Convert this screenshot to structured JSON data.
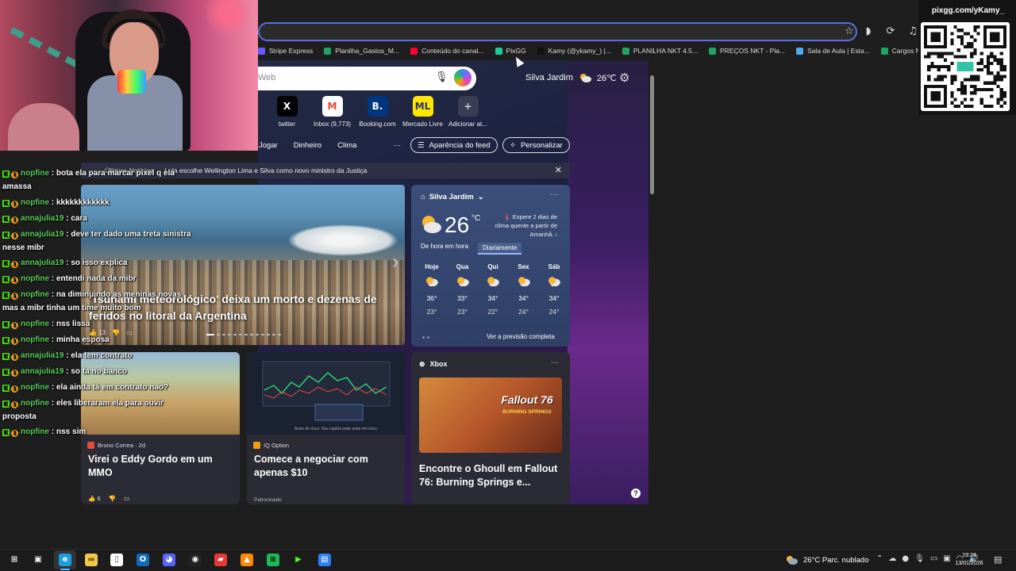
{
  "browser": {
    "address_icons": [
      "star-icon",
      "extension-icon",
      "refresh-icon",
      "music-icon"
    ],
    "bookmarks": [
      {
        "label": "Stripe Express",
        "color": "#635bff"
      },
      {
        "label": "Planilha_Gastos_M...",
        "color": "#1fa463"
      },
      {
        "label": "Conteúdo do canal...",
        "color": "#ff0033"
      },
      {
        "label": "PixGG",
        "color": "#20c997"
      },
      {
        "label": "Kamy (@ykamy_) |...",
        "color": "#111111"
      },
      {
        "label": "PLANILHA NKT 4.5...",
        "color": "#1fa463"
      },
      {
        "label": "PREÇOS NKT - Pla...",
        "color": "#1fa463"
      },
      {
        "label": "Sala de Aula | Esta...",
        "color": "#4dabf7"
      },
      {
        "label": "Cargos Ninjas - Pla...",
        "color": "#1fa463"
      }
    ]
  },
  "ntp": {
    "search_placeholder": "Web",
    "weather_location": "Silva Jardim",
    "weather_temp": "26℃",
    "quicklinks": [
      {
        "label": "twitter",
        "glyph": "X",
        "bg": "#000000",
        "fg": "#ffffff"
      },
      {
        "label": "Inbox (9,773)",
        "glyph": "M",
        "bg": "#ffffff",
        "fg": "#ea4335"
      },
      {
        "label": "Booking.com",
        "glyph": "B.",
        "bg": "#003580",
        "fg": "#ffffff"
      },
      {
        "label": "Mercado Livre",
        "glyph": "ML",
        "bg": "#ffe600",
        "fg": "#2d3277"
      },
      {
        "label": "Adicionar at...",
        "glyph": "+",
        "bg": "#3a3d55",
        "fg": "#cccccc"
      }
    ],
    "nav": [
      "Jogar",
      "Dinheiro",
      "Clima"
    ],
    "nav_more": "···",
    "feed_button": "Aparência do feed",
    "customize_button": "Personalizar",
    "ticker_title": "Últimas Notícias",
    "ticker_text": "Lula escolhe Wellington Lima e Silva como novo ministro da Justiça",
    "ticker_close": "✕",
    "hero": {
      "title": "'Tsunami meteorológico' deixa um morto e dezenas de feridos no litoral da Argentina",
      "likes": "13"
    },
    "weather_card": {
      "location": "Silva Jardim",
      "temp": "26",
      "unit": "°C",
      "alert": "Espere 2 dias de clima quente a partir de Amanhã.",
      "tab_hourly": "De hora em hora",
      "tab_daily": "Diariamente",
      "full_forecast": "Ver a previsão completa",
      "more": "···",
      "days": [
        {
          "name": "Hoje",
          "hi": "36°",
          "lo": "23°"
        },
        {
          "name": "Qua",
          "hi": "33°",
          "lo": "23°"
        },
        {
          "name": "Qui",
          "hi": "34°",
          "lo": "22°"
        },
        {
          "name": "Sex",
          "hi": "34°",
          "lo": "24°"
        },
        {
          "name": "Sáb",
          "hi": "34°",
          "lo": "24°"
        }
      ]
    },
    "cards": [
      {
        "source": "Bruno Correa · 2d",
        "title": "Virei o Eddy Gordo em um MMO",
        "likes": "6"
      },
      {
        "source": "IQ Option",
        "title": "Comece a negociar com apenas $10",
        "caption": "Aviso de risco: Seu capital pode estar em risco",
        "sponsored": "Patrocinado"
      },
      {
        "source": "Xbox",
        "title": "Encontre o Ghoull em Fallout 76: Burning Springs e...",
        "logo": "Fallout 76",
        "logo_sub": "BURNING SPRINGS",
        "more": "···"
      }
    ]
  },
  "chat": [
    {
      "user": "nopfine",
      "msg": "bota ela para marcar pixel q ela amassa"
    },
    {
      "user": "nopfine",
      "msg": "kkkkkkkkkkkk"
    },
    {
      "user": "annajulia19",
      "msg": "cara"
    },
    {
      "user": "annajulia19",
      "msg": "deve ter dado uma treta sinistra nesse mibr"
    },
    {
      "user": "annajulia19",
      "msg": "so isso explica"
    },
    {
      "user": "nopfine",
      "msg": "entendi nada da mibr"
    },
    {
      "user": "nopfine",
      "msg": "na diminuindo as meninas novas mas a mibr tinha um time muito bom"
    },
    {
      "user": "nopfine",
      "msg": "nss lissa"
    },
    {
      "user": "nopfine",
      "msg": "minha esposa"
    },
    {
      "user": "annajulia19",
      "msg": "ela tem contrato"
    },
    {
      "user": "annajulia19",
      "msg": "so ta no banco"
    },
    {
      "user": "nopfine",
      "msg": "ela ainda tá em contrato nao?"
    },
    {
      "user": "nopfine",
      "msg": "eles liberaram ela para ouvir proposta"
    },
    {
      "user": "nopfine",
      "msg": "nss sim"
    }
  ],
  "qr": {
    "url": "pixgg.com/yKamy_"
  },
  "taskbar": {
    "apps": [
      {
        "name": "start-icon",
        "glyph": "⊞",
        "bg": "transparent",
        "fg": "#ffffff"
      },
      {
        "name": "taskview-icon",
        "glyph": "▣",
        "bg": "transparent",
        "fg": "#ffffff"
      },
      {
        "name": "edge-icon",
        "glyph": "e",
        "bg": "#1b9de2",
        "fg": "#ffffff"
      },
      {
        "name": "explorer-icon",
        "glyph": "▬",
        "bg": "#f2c94c",
        "fg": "#8a6a10"
      },
      {
        "name": "notepad-icon",
        "glyph": "▯",
        "bg": "#ffffff",
        "fg": "#555555"
      },
      {
        "name": "outlook-icon",
        "glyph": "O",
        "bg": "#0f6cbd",
        "fg": "#ffffff"
      },
      {
        "name": "discord-icon",
        "glyph": "◕",
        "bg": "#5865f2",
        "fg": "#ffffff"
      },
      {
        "name": "obs-icon",
        "glyph": "◉",
        "bg": "#222222",
        "fg": "#ffffff"
      },
      {
        "name": "streamlabs-icon",
        "glyph": "▰",
        "bg": "#e53935",
        "fg": "#ffffff"
      },
      {
        "name": "vlc-icon",
        "glyph": "▲",
        "bg": "#ff8800",
        "fg": "#ffffff"
      },
      {
        "name": "spotify-icon",
        "glyph": "≋",
        "bg": "#1db954",
        "fg": "#000000"
      },
      {
        "name": "kick-icon",
        "glyph": "▶",
        "bg": "#1c1c1c",
        "fg": "#53fc18"
      },
      {
        "name": "app-icon",
        "glyph": "▤",
        "bg": "#2d7ff9",
        "fg": "#ffffff"
      }
    ],
    "weather": "26°C Parc. nublado",
    "time": "19:24",
    "date": "13/01/2026"
  }
}
